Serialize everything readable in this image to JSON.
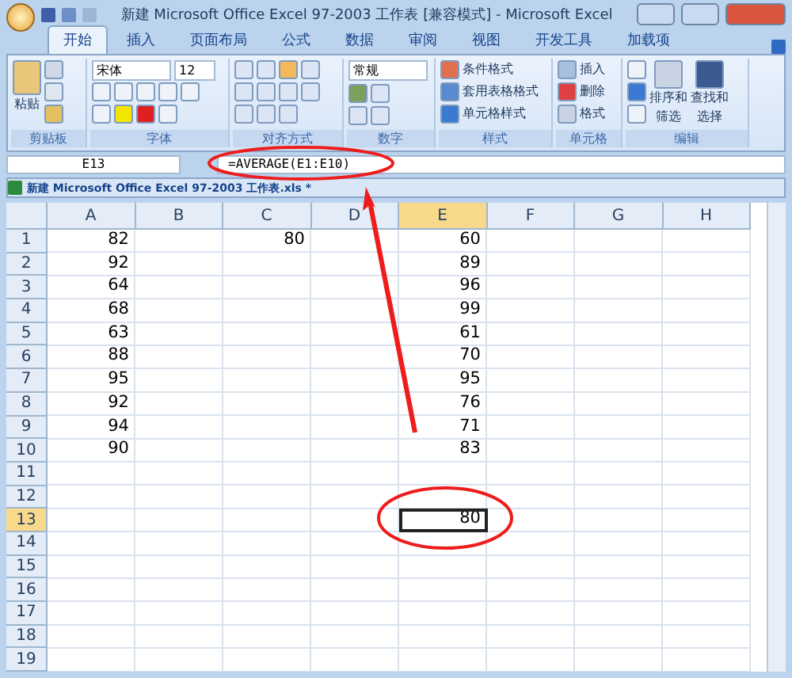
{
  "window": {
    "title": "新建 Microsoft Office Excel 97-2003 工作表 [兼容模式] - Microsoft Excel"
  },
  "tabs": [
    {
      "label": "开始",
      "selected": true
    },
    {
      "label": "插入",
      "selected": false
    },
    {
      "label": "页面布局",
      "selected": false
    },
    {
      "label": "公式",
      "selected": false
    },
    {
      "label": "数据",
      "selected": false
    },
    {
      "label": "审阅",
      "selected": false
    },
    {
      "label": "视图",
      "selected": false
    },
    {
      "label": "开发工具",
      "selected": false
    },
    {
      "label": "加载项",
      "selected": false
    }
  ],
  "ribbon": {
    "clipboard": {
      "paste": "粘贴",
      "group": "剪贴板"
    },
    "font": {
      "name": "宋体",
      "size": "12",
      "group": "字体"
    },
    "alignment": {
      "group": "对齐方式"
    },
    "number": {
      "format": "常规",
      "group": "数字"
    },
    "styles": {
      "items": [
        "条件格式",
        "套用表格格式",
        "单元格样式"
      ],
      "group": "样式"
    },
    "cells": {
      "items": [
        "插入",
        "删除",
        "格式"
      ],
      "group": "单元格"
    },
    "editing": {
      "buttons": [
        {
          "lines": [
            "排序和",
            "筛选"
          ]
        },
        {
          "lines": [
            "查找和",
            "选择"
          ]
        }
      ],
      "group": "编辑"
    }
  },
  "formula_bar": {
    "name_box": "E13",
    "formula": "=AVERAGE(E1:E10)"
  },
  "workbook_tab": "新建 Microsoft Office Excel 97-2003 工作表.xls *",
  "sheet": {
    "columns": [
      {
        "label": "A",
        "selected": false
      },
      {
        "label": "B",
        "selected": false
      },
      {
        "label": "C",
        "selected": false
      },
      {
        "label": "D",
        "selected": false
      },
      {
        "label": "E",
        "selected": true
      },
      {
        "label": "F",
        "selected": false
      },
      {
        "label": "G",
        "selected": false
      },
      {
        "label": "H",
        "selected": false
      }
    ],
    "rows": [
      {
        "label": "1",
        "selected": false,
        "cells": {
          "A": "82",
          "C": "80",
          "E": "60"
        }
      },
      {
        "label": "2",
        "selected": false,
        "cells": {
          "A": "92",
          "E": "89"
        }
      },
      {
        "label": "3",
        "selected": false,
        "cells": {
          "A": "64",
          "E": "96"
        }
      },
      {
        "label": "4",
        "selected": false,
        "cells": {
          "A": "68",
          "E": "99"
        }
      },
      {
        "label": "5",
        "selected": false,
        "cells": {
          "A": "63",
          "E": "61"
        }
      },
      {
        "label": "6",
        "selected": false,
        "cells": {
          "A": "88",
          "E": "70"
        }
      },
      {
        "label": "7",
        "selected": false,
        "cells": {
          "A": "95",
          "E": "95"
        }
      },
      {
        "label": "8",
        "selected": false,
        "cells": {
          "A": "92",
          "E": "76"
        }
      },
      {
        "label": "9",
        "selected": false,
        "cells": {
          "A": "94",
          "E": "71"
        }
      },
      {
        "label": "10",
        "selected": false,
        "cells": {
          "A": "90",
          "E": "83"
        }
      },
      {
        "label": "11",
        "selected": false,
        "cells": {}
      },
      {
        "label": "12",
        "selected": false,
        "cells": {}
      },
      {
        "label": "13",
        "selected": true,
        "cells": {
          "E": "80"
        }
      },
      {
        "label": "14",
        "selected": false,
        "cells": {}
      },
      {
        "label": "15",
        "selected": false,
        "cells": {}
      },
      {
        "label": "16",
        "selected": false,
        "cells": {}
      },
      {
        "label": "17",
        "selected": false,
        "cells": {}
      },
      {
        "label": "18",
        "selected": false,
        "cells": {}
      },
      {
        "label": "19",
        "selected": false,
        "cells": {}
      }
    ]
  }
}
